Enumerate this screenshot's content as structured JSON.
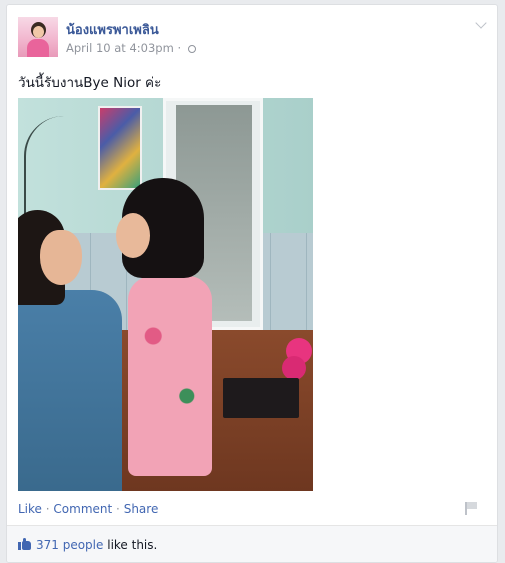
{
  "post": {
    "author": "น้องแพรพาเพลิน",
    "timestamp": "April 10 at 4:03pm",
    "separator": "·",
    "privacy_icon": "globe-icon",
    "options_icon": "chevron-down-icon",
    "text": "วันนี้รับงานBye Nior ค่ะ",
    "photo_icon": "photo"
  },
  "actions": {
    "like": "Like",
    "sep1": "·",
    "comment": "Comment",
    "sep2": "·",
    "share": "Share",
    "report_icon": "flag-icon"
  },
  "likes": {
    "count_link": "371 people",
    "suffix": "like this."
  },
  "colors": {
    "link": "#4267b2",
    "name": "#3b5998",
    "meta": "#90949c",
    "background": "#e9ebee"
  }
}
